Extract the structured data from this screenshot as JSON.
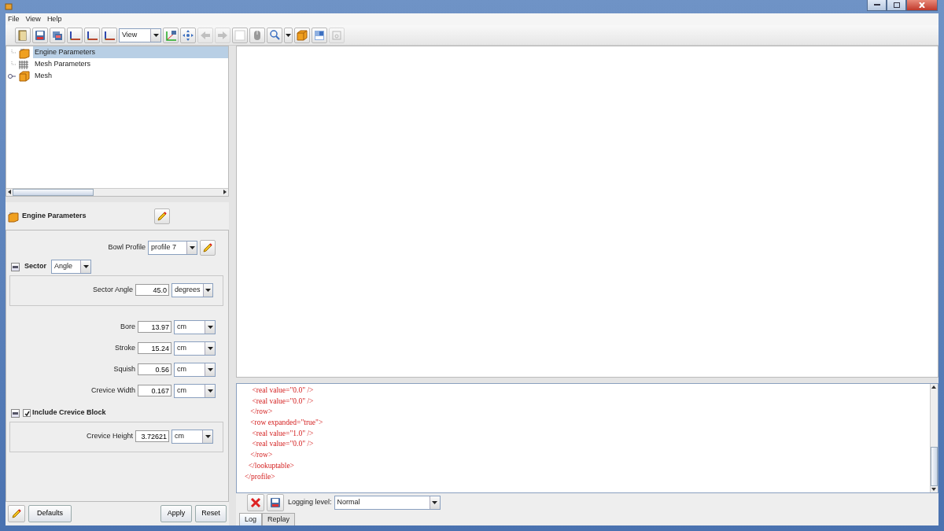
{
  "menu": [
    "File",
    "View",
    "Help"
  ],
  "toolbar": [
    {
      "kind": "button",
      "disabled": false
    },
    {
      "kind": "button",
      "disabled": false
    },
    {
      "kind": "button",
      "disabled": false
    },
    {
      "kind": "button",
      "disabled": false
    },
    {
      "kind": "button",
      "disabled": false
    },
    {
      "kind": "button",
      "disabled": false
    },
    {
      "kind": "combo",
      "value": "View"
    },
    {
      "kind": "button",
      "disabled": false
    },
    {
      "kind": "button",
      "disabled": false
    },
    {
      "kind": "button",
      "disabled": true
    },
    {
      "kind": "button",
      "disabled": true
    },
    {
      "kind": "button",
      "disabled": false
    },
    {
      "kind": "button",
      "disabled": false
    },
    {
      "kind": "split",
      "disabled": false
    },
    {
      "kind": "button",
      "disabled": false
    },
    {
      "kind": "button",
      "disabled": false
    },
    {
      "kind": "button",
      "disabled": true
    }
  ],
  "tree": [
    {
      "label": "Engine Parameters",
      "selected": true
    },
    {
      "label": "Mesh Parameters",
      "selected": false
    },
    {
      "label": "Mesh",
      "selected": false,
      "expanded": false
    }
  ],
  "properties": {
    "title": "Engine Parameters",
    "bowl_profile": {
      "label": "Bowl Profile",
      "value": "profile 7"
    },
    "sector": {
      "label": "Sector",
      "value": "Angle",
      "expanded": true,
      "fields": [
        {
          "label": "Sector Angle",
          "value": "45.0",
          "unit": "degrees"
        }
      ]
    },
    "fields": [
      {
        "label": "Bore",
        "value": "13.97",
        "unit": "cm"
      },
      {
        "label": "Stroke",
        "value": "15.24",
        "unit": "cm"
      },
      {
        "label": "Squish",
        "value": "0.56",
        "unit": "cm"
      },
      {
        "label": "Crevice Width",
        "value": "0.167",
        "unit": "cm"
      }
    ],
    "crevice_block": {
      "label": "Include Crevice Block",
      "checked": true,
      "expanded": true,
      "fields": [
        {
          "label": "Crevice Height",
          "value": "3.72621",
          "unit": "cm"
        }
      ]
    },
    "buttons_left": [
      "Defaults"
    ],
    "buttons_right": [
      "Apply",
      "Reset"
    ]
  },
  "log": {
    "lines": [
      "    <real value=\"0.0\" />",
      "    <real value=\"0.0\" />",
      "   </row>",
      "   <row expanded=\"true\">",
      "    <real value=\"1.0\" />",
      "    <real value=\"0.0\" />",
      "   </row>",
      "  </lookuptable>",
      "</profile>"
    ],
    "logging_level": {
      "label": "Logging level:",
      "value": "Normal"
    },
    "tabs": [
      {
        "label": "Log",
        "selected": true
      },
      {
        "label": "Replay",
        "selected": false
      }
    ]
  }
}
